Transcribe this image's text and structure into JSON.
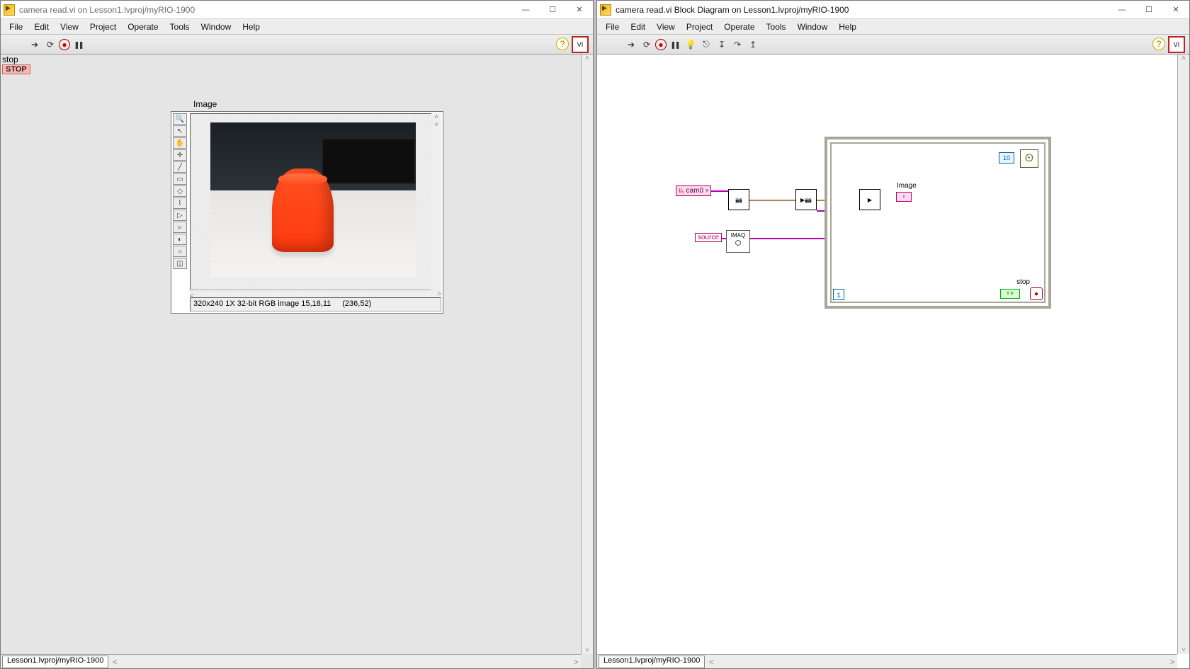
{
  "left_window": {
    "title": "camera read.vi on Lesson1.lvproj/myRIO-1900",
    "menubar": [
      "File",
      "Edit",
      "View",
      "Project",
      "Operate",
      "Tools",
      "Window",
      "Help"
    ],
    "stop_label": "stop",
    "stop_button": "STOP",
    "image_label": "Image",
    "image_status_info": "320x240 1X 32-bit RGB image 15,18,11",
    "image_status_coords": "(236,52)",
    "status_path": "Lesson1.lvproj/myRIO-1900"
  },
  "right_window": {
    "title": "camera read.vi Block Diagram on Lesson1.lvproj/myRIO-1900",
    "menubar": [
      "File",
      "Edit",
      "View",
      "Project",
      "Operate",
      "Tools",
      "Window",
      "Help"
    ],
    "cam_constant": "cam0",
    "source_constant": "source",
    "imaq_label": "IMAQ",
    "image_terminal_label": "Image",
    "timer_value": "10",
    "iter_label": "i",
    "stop_label": "stop",
    "stop_term": "T F",
    "status_path": "Lesson1.lvproj/myRIO-1900"
  }
}
